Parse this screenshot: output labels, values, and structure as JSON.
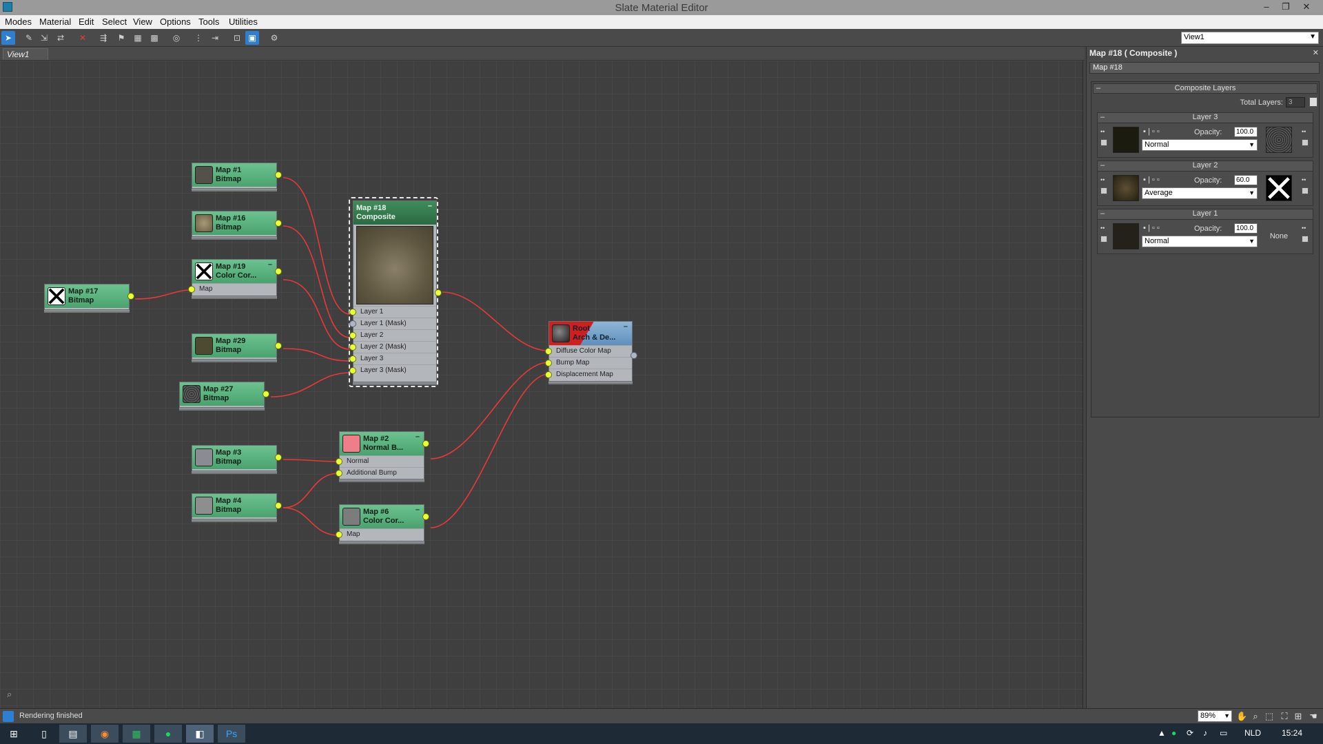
{
  "window": {
    "title": "Slate Material Editor"
  },
  "menu": [
    "Modes",
    "Material",
    "Edit",
    "Select",
    "View",
    "Options",
    "Tools",
    "Utilities"
  ],
  "toolbar": {
    "view_select": "View1"
  },
  "view_tab": "View1",
  "nodes": {
    "map1": {
      "title": "Map #1",
      "type": "Bitmap"
    },
    "map16": {
      "title": "Map #16",
      "type": "Bitmap"
    },
    "map19": {
      "title": "Map #19",
      "type": "Color Cor...",
      "slot": "Map"
    },
    "map17": {
      "title": "Map #17",
      "type": "Bitmap"
    },
    "map29": {
      "title": "Map #29",
      "type": "Bitmap"
    },
    "map27": {
      "title": "Map #27",
      "type": "Bitmap"
    },
    "map18": {
      "title": "Map #18",
      "type": "Composite",
      "slots": [
        "Layer 1",
        "Layer 1 (Mask)",
        "Layer 2",
        "Layer 2 (Mask)",
        "Layer 3",
        "Layer 3 (Mask)"
      ]
    },
    "root": {
      "title": "Root",
      "type": "Arch & De...",
      "slots": [
        "Diffuse Color Map",
        "Bump Map",
        "Displacement Map"
      ]
    },
    "map3": {
      "title": "Map #3",
      "type": "Bitmap"
    },
    "map2": {
      "title": "Map #2",
      "type": "Normal B...",
      "slots": [
        "Normal",
        "Additional Bump"
      ]
    },
    "map4": {
      "title": "Map #4",
      "type": "Bitmap"
    },
    "map6": {
      "title": "Map #6",
      "type": "Color Cor...",
      "slot": "Map"
    }
  },
  "panel": {
    "title": "Map #18  ( Composite )",
    "name": "Map #18",
    "rollout": "Composite Layers",
    "total_layers_label": "Total Layers:",
    "total_layers": "3",
    "opacity_label": "Opacity:",
    "layers": [
      {
        "name": "Layer 3",
        "opacity": "100.0",
        "blend": "Normal",
        "mask": "texture"
      },
      {
        "name": "Layer 2",
        "opacity": "60.0",
        "blend": "Average",
        "mask": "x-icon"
      },
      {
        "name": "Layer 1",
        "opacity": "100.0",
        "blend": "Normal",
        "mask_text": "None"
      }
    ]
  },
  "status": {
    "text": "Rendering finished",
    "zoom": "89%"
  },
  "taskbar": {
    "lang": "NLD",
    "time": "15:24"
  },
  "colors": {
    "node_green": "#5bb47f",
    "composite_header": "#2e6e46",
    "root_header": "#6f9ac4",
    "wire": "#e8393a",
    "pin": "#e9ff3a",
    "swatch_pink": "#f07e8a"
  },
  "icons": [
    "select-icon",
    "pick-material-icon",
    "delete-icon",
    "layout-icon",
    "view-icon",
    "options-icon",
    "zoom-icon",
    "pan-icon",
    "binoculars-icon"
  ]
}
